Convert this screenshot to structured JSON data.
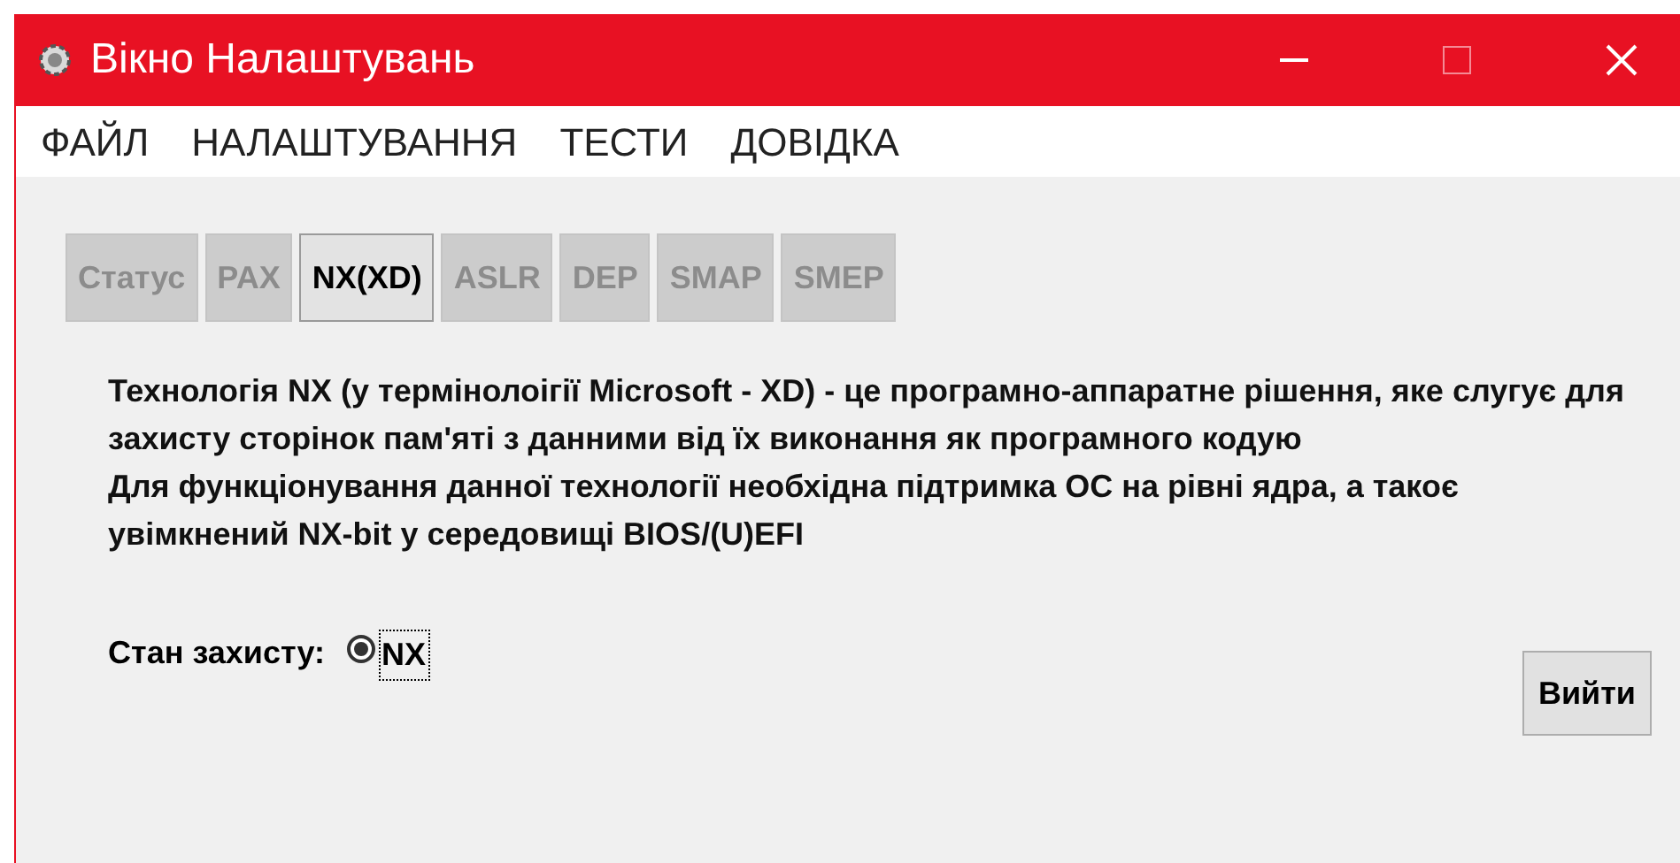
{
  "window": {
    "title": "Вікно Налаштувань"
  },
  "menu": [
    "ФАЙЛ",
    "НАЛАШТУВАННЯ",
    "ТЕСТИ",
    "ДОВІДКА"
  ],
  "tabs": [
    {
      "label": "Статус",
      "selected": false
    },
    {
      "label": "PAX",
      "selected": false
    },
    {
      "label": "NX(XD)",
      "selected": true
    },
    {
      "label": "ASLR",
      "selected": false
    },
    {
      "label": "DEP",
      "selected": false
    },
    {
      "label": "SMAP",
      "selected": false
    },
    {
      "label": "SMEP",
      "selected": false
    }
  ],
  "description": [
    "Технологія NX (у термінолоігії Microsoft - XD) - це програмно-аппаратне рішення, яке слугує для захисту сторінок пам'яті з данними від їх виконання як програмного кодую",
    "Для функціонування данної технології необхідна підтримка ОС на рівні ядра, а такоє увімкнений NX-bit у середовищі BIOS/(U)EFI"
  ],
  "protection": {
    "label": "Стан захисту:",
    "option": "NX",
    "checked": true
  },
  "buttons": [
    "Вийти"
  ]
}
